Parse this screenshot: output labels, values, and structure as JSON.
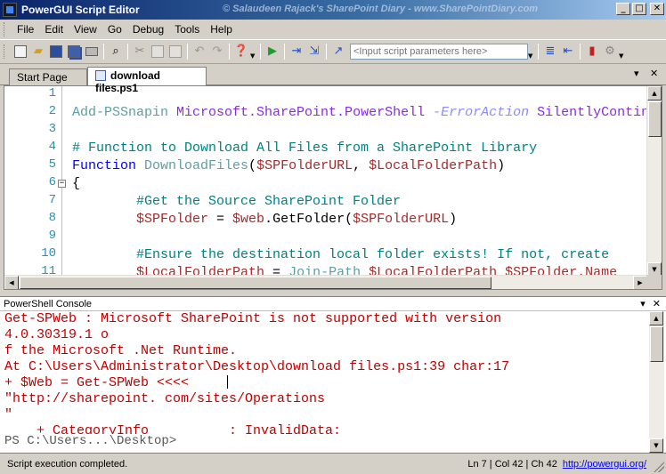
{
  "window": {
    "title": "PowerGUI Script Editor",
    "watermark": "© Salaudeen Rajack's SharePoint Diary - www.SharePointDiary.com",
    "minimize": "_",
    "maximize": "□",
    "close": "✕"
  },
  "menu": [
    "File",
    "Edit",
    "View",
    "Go",
    "Debug",
    "Tools",
    "Help"
  ],
  "toolbar": {
    "script_params_placeholder": "<Input script parameters here>"
  },
  "tabs": [
    {
      "label": "Start Page",
      "active": false
    },
    {
      "label": "download files.ps1",
      "active": true
    }
  ],
  "tab_controls": {
    "dropdown": "▾",
    "close": "✕"
  },
  "editor": {
    "line_numbers": [
      "1",
      "2",
      "3",
      "4",
      "5",
      "6",
      "7",
      "8",
      "9",
      "10",
      "11"
    ],
    "lines": [
      [],
      [
        {
          "t": "Add-PSSnapin ",
          "c": "cmdlet"
        },
        {
          "t": "Microsoft.SharePoint.PowerShell ",
          "c": "ns"
        },
        {
          "t": "-ErrorAction ",
          "c": "param"
        },
        {
          "t": "SilentlyContinue",
          "c": "ns"
        }
      ],
      [],
      [
        {
          "t": "# Function to Download All Files from a SharePoint Library",
          "c": "cm"
        }
      ],
      [
        {
          "t": "Function ",
          "c": "kw"
        },
        {
          "t": "DownloadFiles",
          "c": "fnname"
        },
        {
          "t": "(",
          "c": "plain"
        },
        {
          "t": "$SPFolderURL",
          "c": "var"
        },
        {
          "t": ", ",
          "c": "plain"
        },
        {
          "t": "$LocalFolderPath",
          "c": "var"
        },
        {
          "t": ")",
          "c": "plain"
        }
      ],
      [
        {
          "t": "{",
          "c": "plain"
        }
      ],
      [
        {
          "t": "        #Get the Source SharePoint Folder",
          "c": "cm"
        }
      ],
      [
        {
          "t": "        ",
          "c": "plain"
        },
        {
          "t": "$SPFolder",
          "c": "var"
        },
        {
          "t": " = ",
          "c": "plain"
        },
        {
          "t": "$web",
          "c": "var"
        },
        {
          "t": ".GetFolder(",
          "c": "plain"
        },
        {
          "t": "$SPFolderURL",
          "c": "var"
        },
        {
          "t": ")",
          "c": "plain"
        }
      ],
      [],
      [
        {
          "t": "        #Ensure the destination local folder exists! If not, create",
          "c": "cm"
        }
      ],
      [
        {
          "t": "        ",
          "c": "plain"
        },
        {
          "t": "$LocalFolderPath",
          "c": "var"
        },
        {
          "t": " = ",
          "c": "plain"
        },
        {
          "t": "Join-Path ",
          "c": "cmdlet"
        },
        {
          "t": "$LocalFolderPath ",
          "c": "var"
        },
        {
          "t": "$SPFolder.Name",
          "c": "var"
        }
      ]
    ]
  },
  "console": {
    "title": "PowerShell Console",
    "controls": {
      "pin": "▾",
      "close": "✕"
    },
    "lines": [
      "Get-SPWeb : Microsoft SharePoint is not supported with version",
      "4.0.30319.1 o",
      "f the Microsoft .Net Runtime.",
      "At C:\\Users\\Administrator\\Desktop\\download files.ps1:39 char:17",
      "+ $Web = Get-SPWeb <<<<",
      "\"http://sharepoint. com/sites/Operations",
      "\"",
      "    + CategoryInfo          : InvalidData:"
    ],
    "prompt": "PS C:\\Users...\\Desktop>"
  },
  "status": {
    "message": "Script execution completed.",
    "position": "Ln 7 | Col 42 | Ch 42",
    "link": "http://powergui.org/"
  }
}
